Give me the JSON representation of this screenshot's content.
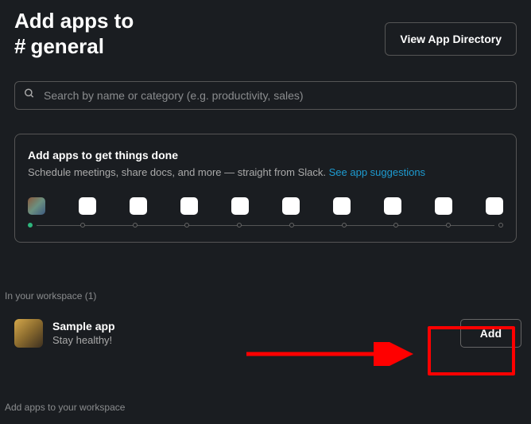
{
  "header": {
    "title": "Add apps to",
    "channel_prefix": "#",
    "channel": "general",
    "directory_button": "View App Directory"
  },
  "search": {
    "placeholder": "Search by name or category (e.g. productivity, sales)"
  },
  "promo": {
    "title": "Add apps to get things done",
    "subtitle": "Schedule meetings, share docs, and more — straight from Slack. ",
    "link": "See app suggestions"
  },
  "workspace_section": {
    "label": "In your workspace (1)"
  },
  "app": {
    "name": "Sample app",
    "desc": "Stay healthy!",
    "add_button": "Add"
  },
  "footer": {
    "label": "Add apps to your workspace"
  }
}
